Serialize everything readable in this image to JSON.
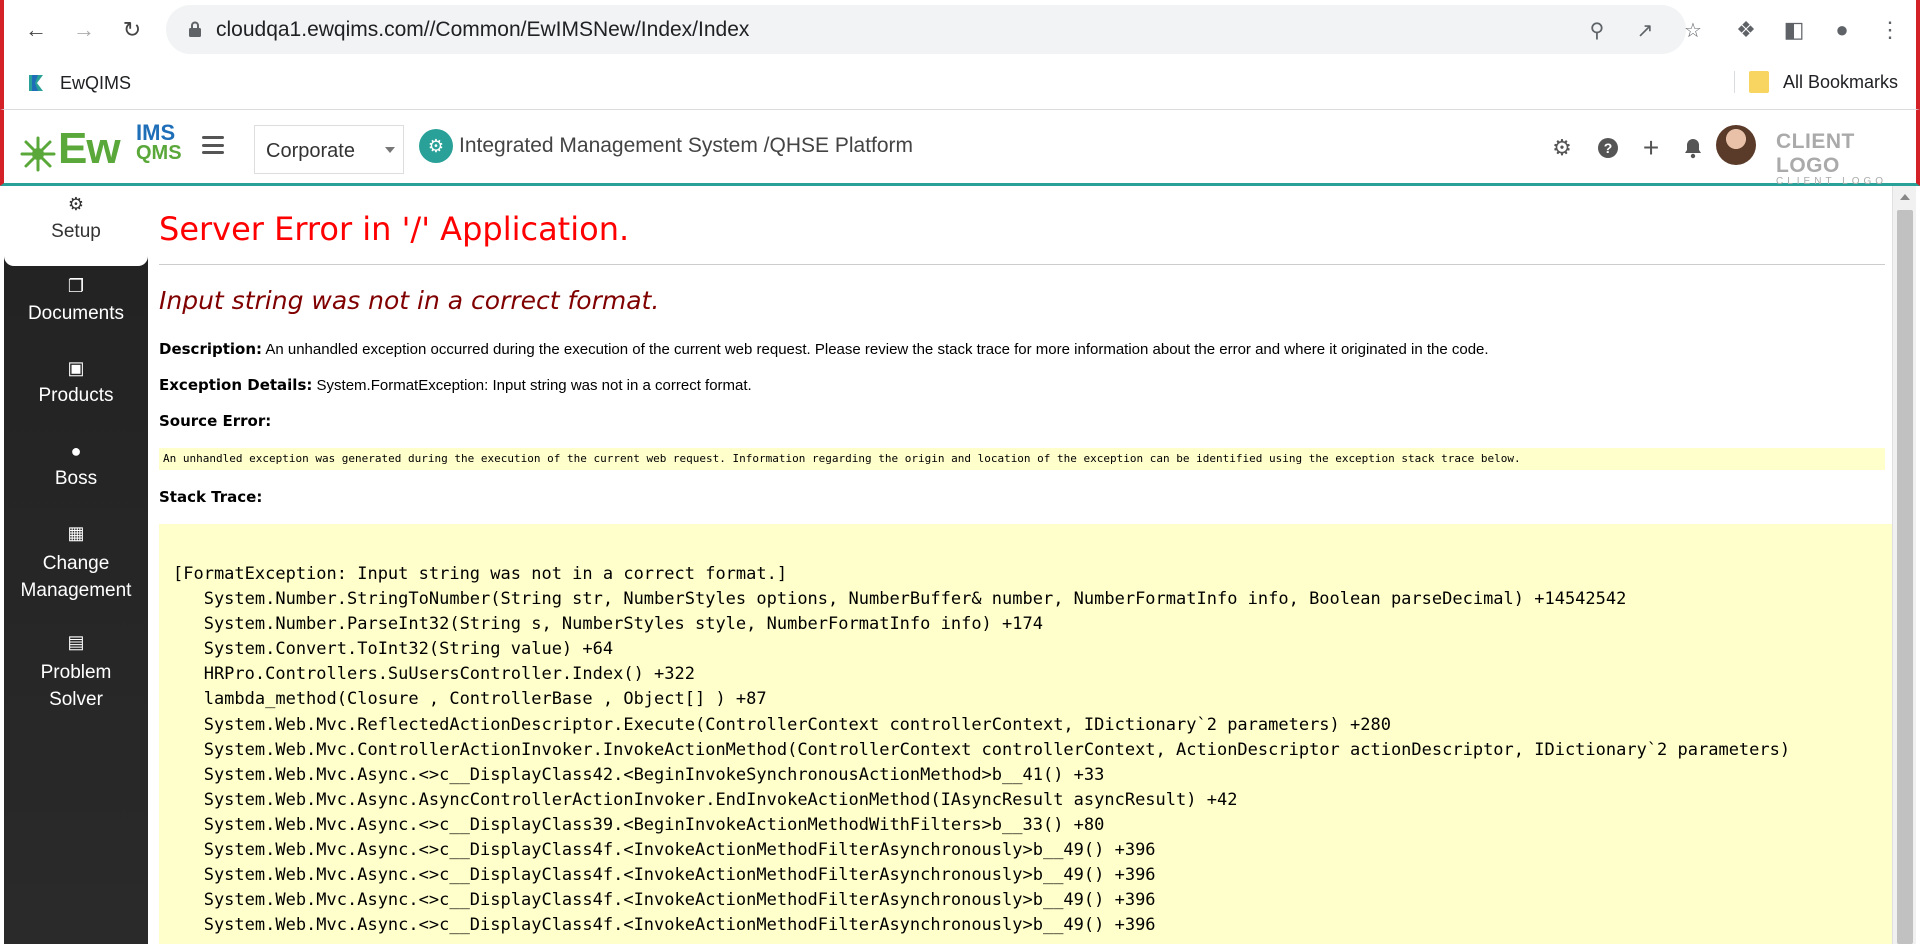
{
  "browser": {
    "url": "cloudqa1.ewqims.com//Common/EwIMSNew/Index/Index",
    "bookmark_site": "EwQIMS",
    "all_bookmarks": "All Bookmarks"
  },
  "header": {
    "logo_main": "Ew",
    "logo_ims": "IMS",
    "logo_qms": "QMS",
    "corporate_selected": "Corporate",
    "platform_title": "Integrated Management System /QHSE Platform",
    "client_logo": "CLIENT LOGO",
    "client_logo_sub": "CLIENT LOGO"
  },
  "sidebar": {
    "items": [
      {
        "label": "Setup",
        "icon": "gears-icon"
      },
      {
        "label": "Documents",
        "icon": "copy-icon"
      },
      {
        "label": "Products",
        "icon": "product-icon"
      },
      {
        "label": "Boss",
        "icon": "user-icon"
      },
      {
        "label": "Change Management",
        "icon": "building-icon"
      },
      {
        "label": "Problem Solver",
        "icon": "solver-icon"
      }
    ]
  },
  "error": {
    "title": "Server Error in '/' Application.",
    "subtitle": "Input string was not in a correct format.",
    "description_label": "Description:",
    "description": "An unhandled exception occurred during the execution of the current web request. Please review the stack trace for more information about the error and where it originated in the code.",
    "exception_label": "Exception Details:",
    "exception": "System.FormatException: Input string was not in a correct format.",
    "source_label": "Source Error:",
    "source": "An unhandled exception was generated during the execution of the current web request. Information regarding the origin and location of the exception can be identified using the exception stack trace below.",
    "stack_label": "Stack Trace:",
    "stack_trace": [
      "[FormatException: Input string was not in a correct format.]",
      "   System.Number.StringToNumber(String str, NumberStyles options, NumberBuffer& number, NumberFormatInfo info, Boolean parseDecimal) +14542542",
      "   System.Number.ParseInt32(String s, NumberStyles style, NumberFormatInfo info) +174",
      "   System.Convert.ToInt32(String value) +64",
      "   HRPro.Controllers.SuUsersController.Index() +322",
      "   lambda_method(Closure , ControllerBase , Object[] ) +87",
      "   System.Web.Mvc.ReflectedActionDescriptor.Execute(ControllerContext controllerContext, IDictionary`2 parameters) +280",
      "   System.Web.Mvc.ControllerActionInvoker.InvokeActionMethod(ControllerContext controllerContext, ActionDescriptor actionDescriptor, IDictionary`2 parameters)",
      "   System.Web.Mvc.Async.<>c__DisplayClass42.<BeginInvokeSynchronousActionMethod>b__41() +33",
      "   System.Web.Mvc.Async.AsyncControllerActionInvoker.EndInvokeActionMethod(IAsyncResult asyncResult) +42",
      "   System.Web.Mvc.Async.<>c__DisplayClass39.<BeginInvokeActionMethodWithFilters>b__33() +80",
      "   System.Web.Mvc.Async.<>c__DisplayClass4f.<InvokeActionMethodFilterAsynchronously>b__49() +396",
      "   System.Web.Mvc.Async.<>c__DisplayClass4f.<InvokeActionMethodFilterAsynchronously>b__49() +396",
      "   System.Web.Mvc.Async.<>c__DisplayClass4f.<InvokeActionMethodFilterAsynchronously>b__49() +396",
      "   System.Web.Mvc.Async.<>c__DisplayClass4f.<InvokeActionMethodFilterAsynchronously>b__49() +396"
    ]
  },
  "colors": {
    "accent": "#2aa198",
    "error_title": "#ff0000",
    "error_subtitle": "#800000",
    "code_bg": "#ffffcc",
    "window_border": "#d42027"
  }
}
